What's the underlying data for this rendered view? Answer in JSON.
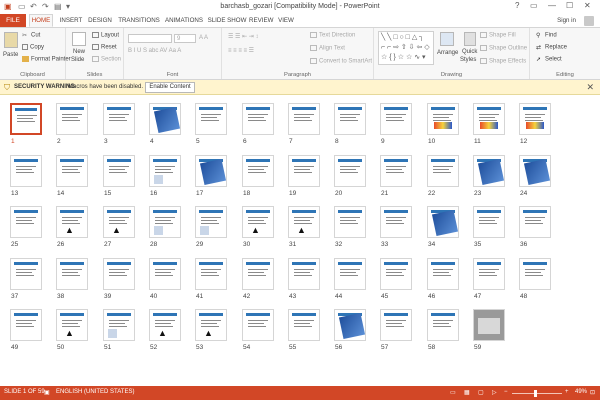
{
  "window": {
    "title": "barchasb_gozari [Compatibility Mode] - PowerPoint",
    "qat": [
      "save-icon",
      "undo-icon",
      "redo-icon",
      "slideshow-icon",
      "customize-icon"
    ],
    "controls": {
      "help": "?",
      "ribbon_display": "▭",
      "minimize": "—",
      "maximize": "☐",
      "close": "✕"
    }
  },
  "tabs": {
    "file": "FILE",
    "items": [
      "HOME",
      "INSERT",
      "DESIGN",
      "TRANSITIONS",
      "ANIMATIONS",
      "SLIDE SHOW",
      "REVIEW",
      "VIEW"
    ],
    "active": "HOME",
    "signin": "Sign in"
  },
  "ribbon": {
    "clipboard": {
      "label": "Clipboard",
      "paste": "Paste",
      "cut": "Cut",
      "copy": "Copy",
      "format_painter": "Format Painter"
    },
    "slides": {
      "label": "Slides",
      "new_slide": "New",
      "new_slide2": "Slide",
      "layout": "Layout",
      "reset": "Reset",
      "section": "Section"
    },
    "font": {
      "label": "Font",
      "size": "9",
      "buttons": "B I U S abc  AV  Aa  A"
    },
    "paragraph": {
      "label": "Paragraph",
      "text_direction": "Text Direction",
      "align_text": "Align Text",
      "convert": "Convert to SmartArt"
    },
    "drawing": {
      "label": "Drawing",
      "arrange": "Arrange",
      "quick_styles": "Quick",
      "quick_styles2": "Styles",
      "shape_fill": "Shape Fill",
      "shape_outline": "Shape Outline",
      "shape_effects": "Shape Effects"
    },
    "editing": {
      "label": "Editing",
      "find": "Find",
      "replace": "Replace",
      "select": "Select"
    }
  },
  "security": {
    "title": "SECURITY WARNING",
    "message": "Macros have been disabled.",
    "button": "Enable Content",
    "close": "✕"
  },
  "slides": {
    "selected": 1,
    "total": 59,
    "items": [
      {
        "n": "1",
        "kind": "text"
      },
      {
        "n": "2",
        "kind": "text"
      },
      {
        "n": "3",
        "kind": "text"
      },
      {
        "n": "4",
        "kind": "pic"
      },
      {
        "n": "5",
        "kind": "text"
      },
      {
        "n": "6",
        "kind": "text"
      },
      {
        "n": "7",
        "kind": "text"
      },
      {
        "n": "8",
        "kind": "text"
      },
      {
        "n": "9",
        "kind": "text"
      },
      {
        "n": "10",
        "kind": "badge"
      },
      {
        "n": "11",
        "kind": "badge"
      },
      {
        "n": "12",
        "kind": "badge"
      },
      {
        "n": "13",
        "kind": "text"
      },
      {
        "n": "14",
        "kind": "text"
      },
      {
        "n": "15",
        "kind": "text"
      },
      {
        "n": "16",
        "kind": "gfx"
      },
      {
        "n": "17",
        "kind": "pic"
      },
      {
        "n": "18",
        "kind": "text"
      },
      {
        "n": "19",
        "kind": "text"
      },
      {
        "n": "20",
        "kind": "text"
      },
      {
        "n": "21",
        "kind": "text"
      },
      {
        "n": "22",
        "kind": "text"
      },
      {
        "n": "23",
        "kind": "pic"
      },
      {
        "n": "24",
        "kind": "pic"
      },
      {
        "n": "25",
        "kind": "text"
      },
      {
        "n": "26",
        "kind": "sym"
      },
      {
        "n": "27",
        "kind": "sym"
      },
      {
        "n": "28",
        "kind": "gfx"
      },
      {
        "n": "29",
        "kind": "gfx"
      },
      {
        "n": "30",
        "kind": "sym"
      },
      {
        "n": "31",
        "kind": "sym"
      },
      {
        "n": "32",
        "kind": "text"
      },
      {
        "n": "33",
        "kind": "text"
      },
      {
        "n": "34",
        "kind": "pic"
      },
      {
        "n": "35",
        "kind": "text"
      },
      {
        "n": "36",
        "kind": "text"
      },
      {
        "n": "37",
        "kind": "text"
      },
      {
        "n": "38",
        "kind": "text"
      },
      {
        "n": "39",
        "kind": "text"
      },
      {
        "n": "40",
        "kind": "text"
      },
      {
        "n": "41",
        "kind": "text"
      },
      {
        "n": "42",
        "kind": "text"
      },
      {
        "n": "43",
        "kind": "text"
      },
      {
        "n": "44",
        "kind": "text"
      },
      {
        "n": "45",
        "kind": "text"
      },
      {
        "n": "46",
        "kind": "text"
      },
      {
        "n": "47",
        "kind": "text"
      },
      {
        "n": "48",
        "kind": "text"
      },
      {
        "n": "49",
        "kind": "text"
      },
      {
        "n": "50",
        "kind": "sym"
      },
      {
        "n": "51",
        "kind": "gfx"
      },
      {
        "n": "52",
        "kind": "sym"
      },
      {
        "n": "53",
        "kind": "sym"
      },
      {
        "n": "54",
        "kind": "text"
      },
      {
        "n": "55",
        "kind": "text"
      },
      {
        "n": "56",
        "kind": "pic"
      },
      {
        "n": "57",
        "kind": "text"
      },
      {
        "n": "58",
        "kind": "text"
      },
      {
        "n": "59",
        "kind": "photo"
      }
    ]
  },
  "status": {
    "slide": "SLIDE 1 OF 59",
    "language": "ENGLISH (UNITED STATES)",
    "zoom": "49%",
    "zoom_fraction": 0.49
  },
  "colors": {
    "accent": "#d24726",
    "security_bg": "#fff4ce",
    "ribbon_bg": "#f7f7f7"
  }
}
